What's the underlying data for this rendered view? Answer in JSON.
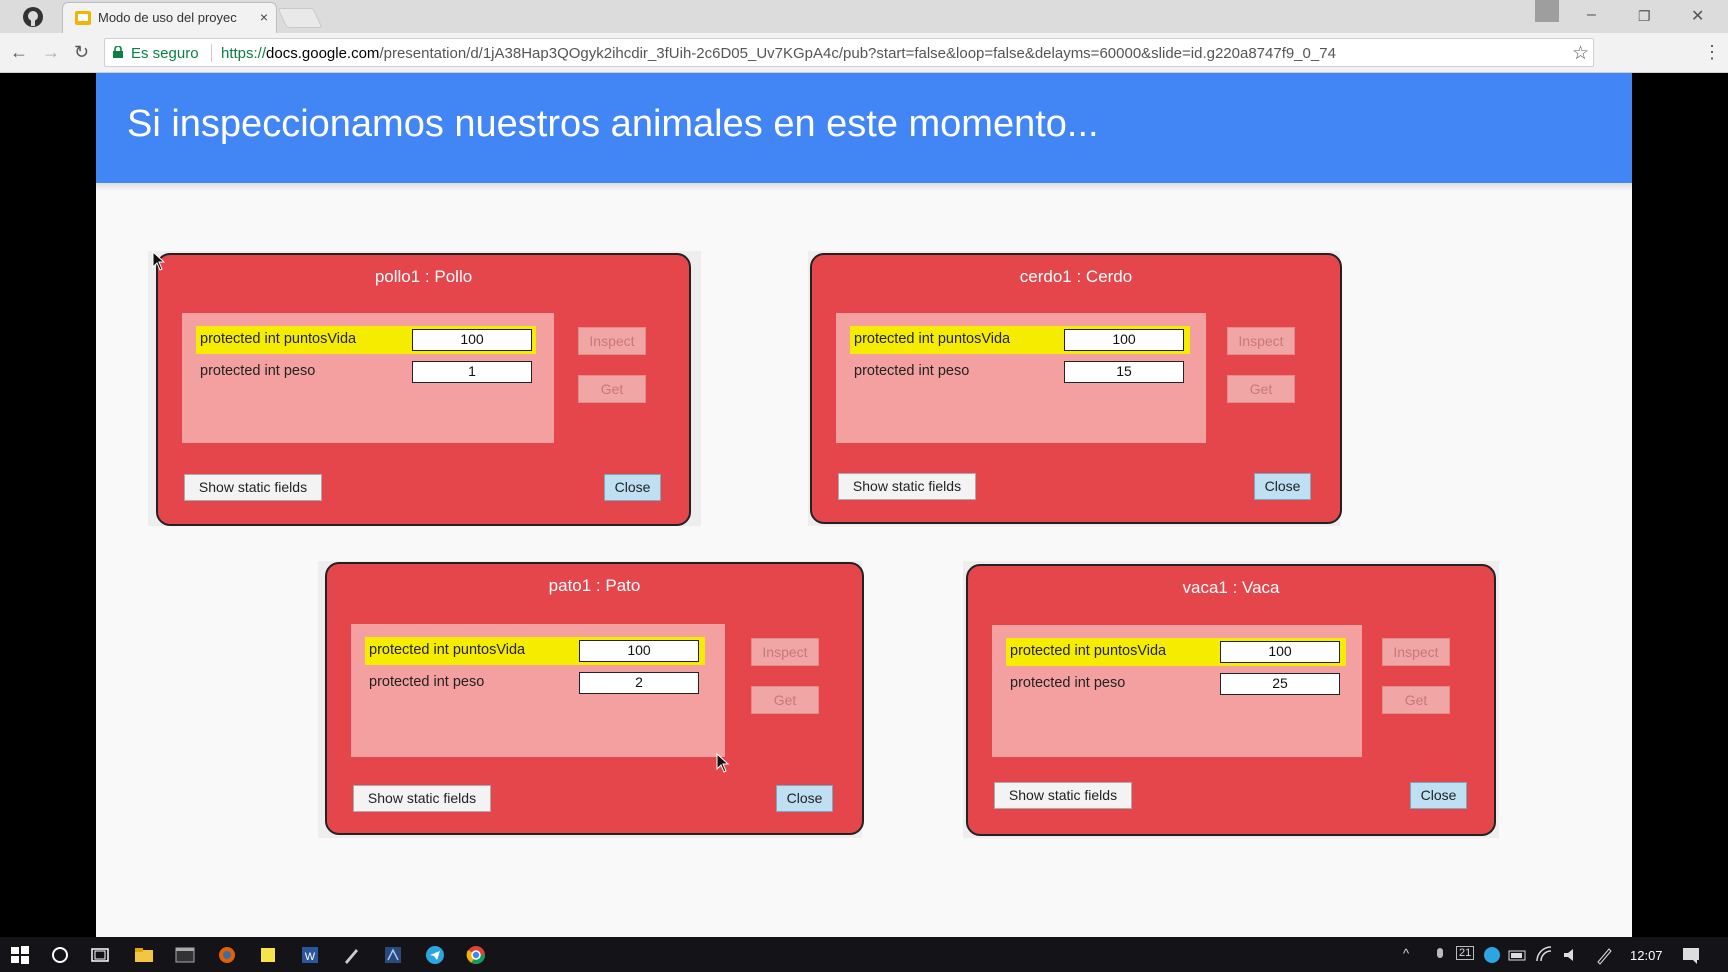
{
  "browser": {
    "tab_title": "Modo de uso del proyec",
    "tab_close": "×",
    "secure_label": "Es seguro",
    "url_scheme": "https://",
    "url_host": "docs.google.com",
    "url_path": "/presentation/d/1jA38Hap3QOgyk2ihcdir_3fUih-2c6D05_Uv7KGpA4c/pub?start=false&loop=false&delayms=60000&slide=id.g220a8747f9_0_74",
    "back_icon": "←",
    "forward_icon": "→",
    "reload_icon": "↻",
    "star_icon": "☆",
    "menu_icon": "⋮",
    "minimize_icon": "–",
    "restore_icon": "❐",
    "close_icon": "✕"
  },
  "slide": {
    "title": "Si inspeccionamos nuestros animales en este momento...",
    "header_color": "#4286f5",
    "windows": [
      {
        "title": "pollo1 : Pollo",
        "fields": [
          {
            "label": "protected int puntosVida",
            "value": "100",
            "highlighted": true
          },
          {
            "label": "protected int peso",
            "value": "1",
            "highlighted": false
          }
        ],
        "inspect_label": "Inspect",
        "get_label": "Get",
        "static_label": "Show static fields",
        "close_label": "Close"
      },
      {
        "title": "cerdo1 : Cerdo",
        "fields": [
          {
            "label": "protected int puntosVida",
            "value": "100",
            "highlighted": true
          },
          {
            "label": "protected int peso",
            "value": "15",
            "highlighted": false
          }
        ],
        "inspect_label": "Inspect",
        "get_label": "Get",
        "static_label": "Show static fields",
        "close_label": "Close"
      },
      {
        "title": "pato1 : Pato",
        "fields": [
          {
            "label": "protected int puntosVida",
            "value": "100",
            "highlighted": true
          },
          {
            "label": "protected int peso",
            "value": "2",
            "highlighted": false
          }
        ],
        "inspect_label": "Inspect",
        "get_label": "Get",
        "static_label": "Show static fields",
        "close_label": "Close"
      },
      {
        "title": "vaca1 : Vaca",
        "fields": [
          {
            "label": "protected int puntosVida",
            "value": "100",
            "highlighted": true
          },
          {
            "label": "protected int peso",
            "value": "25",
            "highlighted": false
          }
        ],
        "inspect_label": "Inspect",
        "get_label": "Get",
        "static_label": "Show static fields",
        "close_label": "Close"
      }
    ]
  },
  "taskbar": {
    "clock": "12:07",
    "tray_badge": "21",
    "icons": [
      "windows-start-icon",
      "cortana-icon",
      "task-view-icon",
      "file-explorer-icon",
      "terminal-icon",
      "firefox-icon",
      "sticky-notes-icon",
      "word-icon",
      "pen-icon",
      "app-icon",
      "telegram-icon",
      "chrome-icon"
    ]
  }
}
